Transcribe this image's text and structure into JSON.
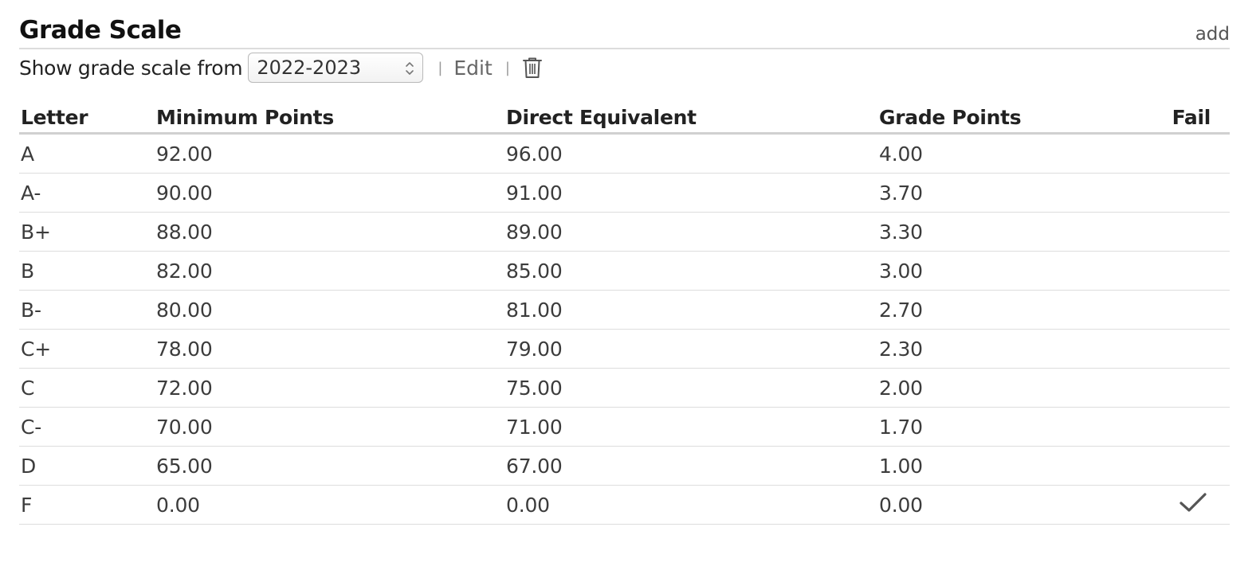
{
  "header": {
    "title": "Grade Scale",
    "add_label": "add"
  },
  "controls": {
    "show_label": "Show grade scale from",
    "selected_year": "2022-2023",
    "separator": "|",
    "edit_label": "Edit",
    "delete_icon": "trash-icon"
  },
  "table": {
    "columns": [
      "Letter",
      "Minimum Points",
      "Direct Equivalent",
      "Grade Points",
      "Fail"
    ],
    "rows": [
      {
        "letter": "A",
        "min": "92.00",
        "direct": "96.00",
        "points": "4.00",
        "fail": false
      },
      {
        "letter": "A-",
        "min": "90.00",
        "direct": "91.00",
        "points": "3.70",
        "fail": false
      },
      {
        "letter": "B+",
        "min": "88.00",
        "direct": "89.00",
        "points": "3.30",
        "fail": false
      },
      {
        "letter": "B",
        "min": "82.00",
        "direct": "85.00",
        "points": "3.00",
        "fail": false
      },
      {
        "letter": "B-",
        "min": "80.00",
        "direct": "81.00",
        "points": "2.70",
        "fail": false
      },
      {
        "letter": "C+",
        "min": "78.00",
        "direct": "79.00",
        "points": "2.30",
        "fail": false
      },
      {
        "letter": "C",
        "min": "72.00",
        "direct": "75.00",
        "points": "2.00",
        "fail": false
      },
      {
        "letter": "C-",
        "min": "70.00",
        "direct": "71.00",
        "points": "1.70",
        "fail": false
      },
      {
        "letter": "D",
        "min": "65.00",
        "direct": "67.00",
        "points": "1.00",
        "fail": false
      },
      {
        "letter": "F",
        "min": "0.00",
        "direct": "0.00",
        "points": "0.00",
        "fail": true
      }
    ]
  },
  "colors": {
    "text": "#3c3c3c",
    "header_text": "#222222",
    "rule": "#dddddd",
    "check": "#555555"
  }
}
